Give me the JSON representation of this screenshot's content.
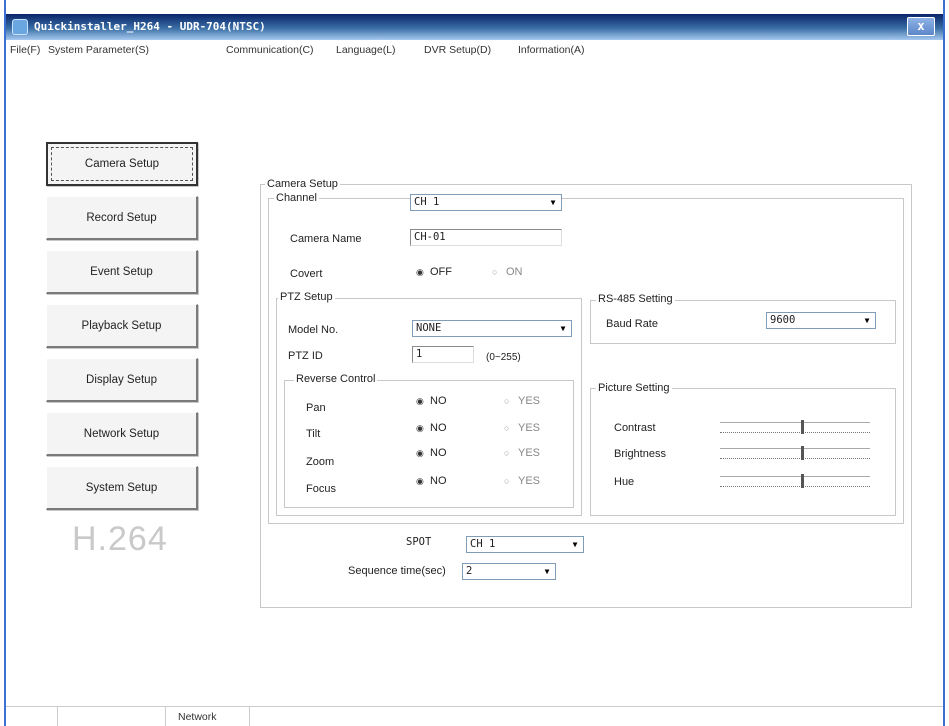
{
  "window": {
    "title": "Quickinstaller_H264 - UDR-704(NTSC)",
    "close_glyph": "x"
  },
  "menu": [
    "File(F)",
    "System Parameter(S)",
    "Communication(C)",
    "Language(L)",
    "DVR Setup(D)",
    "Information(A)"
  ],
  "sidebar": {
    "buttons": [
      "Camera Setup",
      "Record Setup",
      "Event Setup",
      "Playback Setup",
      "Display Setup",
      "Network Setup",
      "System Setup"
    ],
    "active_index": 0,
    "brand": "H.264"
  },
  "camera_setup": {
    "group_title": "Camera Setup",
    "channel_label": "Channel",
    "channel_value": "CH 1",
    "camera_name_label": "Camera Name",
    "camera_name_value": "CH-01",
    "covert_label": "Covert",
    "covert_off": "OFF",
    "covert_on": "ON",
    "covert_selected": "OFF"
  },
  "ptz": {
    "group_title": "PTZ Setup",
    "model_label": "Model No.",
    "model_value": "NONE",
    "id_label": "PTZ ID",
    "id_value": "1",
    "id_range": "(0~255)",
    "reverse_title": "Reverse Control",
    "no_label": "NO",
    "yes_label": "YES",
    "rows": [
      {
        "label": "Pan",
        "selected": "NO"
      },
      {
        "label": "Tilt",
        "selected": "NO"
      },
      {
        "label": "Zoom",
        "selected": "NO"
      },
      {
        "label": "Focus",
        "selected": "NO"
      }
    ]
  },
  "rs485": {
    "group_title": "RS-485 Setting",
    "baud_label": "Baud Rate",
    "baud_value": "9600"
  },
  "picture": {
    "group_title": "Picture Setting",
    "sliders": [
      {
        "label": "Contrast",
        "level": 0.55
      },
      {
        "label": "Brightness",
        "level": 0.55
      },
      {
        "label": "Hue",
        "level": 0.55
      }
    ]
  },
  "spot": {
    "label": "SPOT",
    "value": "CH 1",
    "sequence_label": "Sequence time(sec)",
    "sequence_value": "2"
  },
  "status_bar": [
    "",
    "",
    "Network"
  ]
}
